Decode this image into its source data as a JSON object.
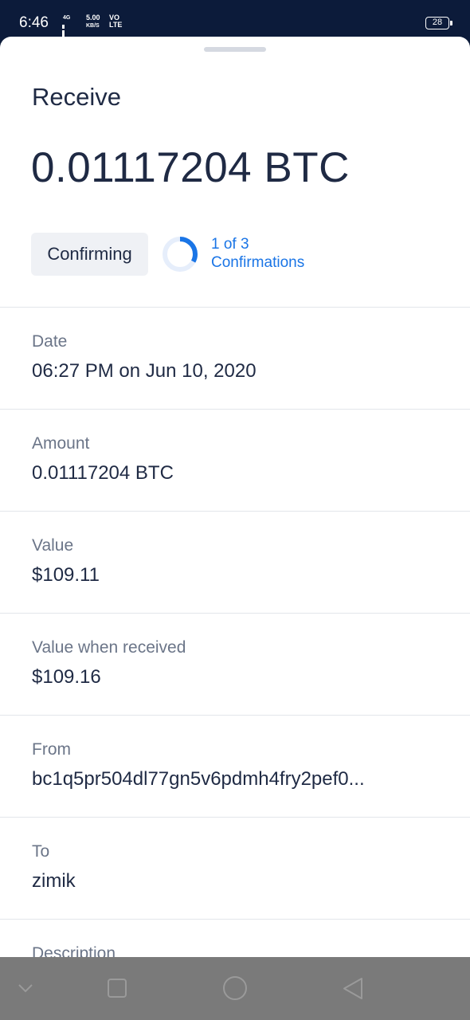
{
  "status_bar": {
    "time": "6:46",
    "network_type": "4G",
    "speed_value": "5.00",
    "speed_unit": "KB/S",
    "volte_top": "VO",
    "volte_bottom": "LTE",
    "battery": "28"
  },
  "sheet": {
    "title": "Receive",
    "amount": "0.01117204 BTC",
    "status_badge": "Confirming",
    "confirmations_count": "1 of 3",
    "confirmations_label": "Confirmations",
    "confirmations_progress": 0.33,
    "accent_color": "#1a75e6"
  },
  "details": [
    {
      "label": "Date",
      "value": "06:27 PM on Jun 10, 2020"
    },
    {
      "label": "Amount",
      "value": "0.01117204 BTC"
    },
    {
      "label": "Value",
      "value": "$109.11"
    },
    {
      "label": "Value when received",
      "value": "$109.16"
    },
    {
      "label": "From",
      "value": "bc1q5pr504dl77gn5v6pdmh4fry2pef0..."
    },
    {
      "label": "To",
      "value": "zimik"
    },
    {
      "label": "Description",
      "value": ""
    }
  ],
  "nav_bar": {
    "icons": [
      "chevron-down-icon",
      "square-icon",
      "circle-icon",
      "triangle-back-icon"
    ]
  }
}
